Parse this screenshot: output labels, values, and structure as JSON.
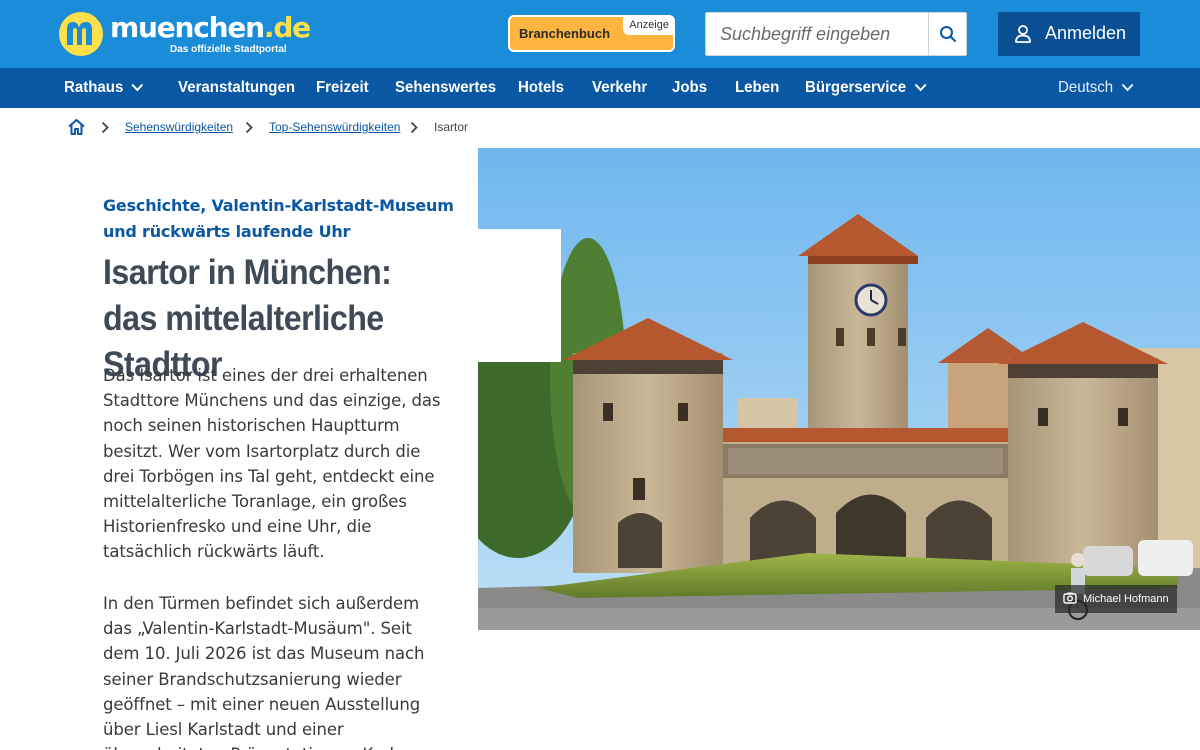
{
  "header": {
    "logo_word": "muenchen",
    "logo_tld": ".de",
    "logo_tagline": "Das offizielle Stadtportal",
    "branchenbuch_label": "Branchenbuch",
    "ad_badge": "Anzeige",
    "search_placeholder": "Suchbegriff eingeben",
    "login_label": "Anmelden",
    "colors": {
      "top": "#1a8cd8",
      "nav": "#0a57a4",
      "login": "#0a4f94",
      "branchen": "#fdb53f",
      "logo_yellow": "#ffe04a"
    }
  },
  "nav": {
    "items": [
      {
        "label": "Rathaus",
        "dropdown": true
      },
      {
        "label": "Veranstaltungen",
        "dropdown": false
      },
      {
        "label": "Freizeit",
        "dropdown": false
      },
      {
        "label": "Sehenswertes",
        "dropdown": false
      },
      {
        "label": "Hotels",
        "dropdown": false
      },
      {
        "label": "Verkehr",
        "dropdown": false
      },
      {
        "label": "Jobs",
        "dropdown": false
      },
      {
        "label": "Leben",
        "dropdown": false
      },
      {
        "label": "Bürgerservice",
        "dropdown": true
      }
    ],
    "language": "Deutsch"
  },
  "breadcrumb": {
    "items": [
      "Sehenswürdigkeiten",
      "Top-Sehenswürdigkeiten"
    ],
    "current": "Isartor"
  },
  "article": {
    "kicker": "Geschichte, Valentin-Karlstadt-Museum und rückwärts laufende Uhr",
    "title": "Isartor in München: das mittelalterliche Stadttor",
    "paragraphs": [
      "Das Isartor ist eines der drei erhaltenen Stadttore Münchens und das einzige, das noch seinen historischen Hauptturm besitzt. Wer vom Isartorplatz durch die drei Torbögen ins Tal geht, entdeckt eine mittelalterliche Toranlage, ein großes Historienfresko und eine Uhr, die tatsächlich rückwärts läuft.",
      "In den Türmen befindet sich außerdem das „Valentin-Karlstadt-Musäum\". Seit dem 10. Juli 2026 ist das Museum nach seiner Brandschutzsanierung wieder geöffnet – mit einer neuen Ausstellung über Liesl Karlstadt und einer überarbeiteten Präsentation zu Karl"
    ]
  },
  "image": {
    "credit": "Michael Hofmann",
    "icon": "camera-icon"
  }
}
